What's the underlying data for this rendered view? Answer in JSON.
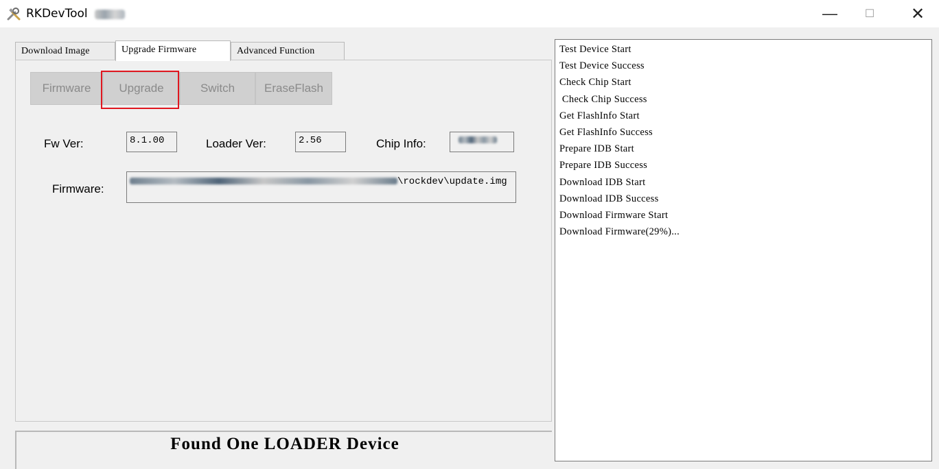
{
  "window": {
    "title": "RKDevTool",
    "minimize_glyph": "—",
    "maximize_glyph": "☐",
    "close_glyph": "✕",
    "icon": "tools-icon"
  },
  "tabs": [
    {
      "label": "Download Image",
      "active": false
    },
    {
      "label": "Upgrade Firmware",
      "active": true
    },
    {
      "label": "Advanced Function",
      "active": false
    }
  ],
  "toolbar": {
    "firmware_label": "Firmware",
    "upgrade_label": "Upgrade",
    "switch_label": "Switch",
    "eraseflash_label": "EraseFlash",
    "highlight_color": "#e0161e"
  },
  "info": {
    "fw_ver_label": "Fw Ver:",
    "fw_ver_value": "8.1.00",
    "loader_ver_label": "Loader Ver:",
    "loader_ver_value": "2.56",
    "chip_info_label": "Chip Info:",
    "firmware_label": "Firmware:",
    "firmware_path_suffix": "\\rockdev\\update.img"
  },
  "status": {
    "text": "Found One LOADER Device"
  },
  "log": {
    "lines": [
      "Test Device Start",
      "Test Device Success",
      "Check Chip Start",
      " Check Chip Success",
      "Get FlashInfo Start",
      "Get FlashInfo Success",
      "Prepare IDB Start",
      "Prepare IDB Success",
      "Download IDB Start",
      "Download IDB Success",
      "Download Firmware Start",
      "Download Firmware(29%)..."
    ]
  }
}
